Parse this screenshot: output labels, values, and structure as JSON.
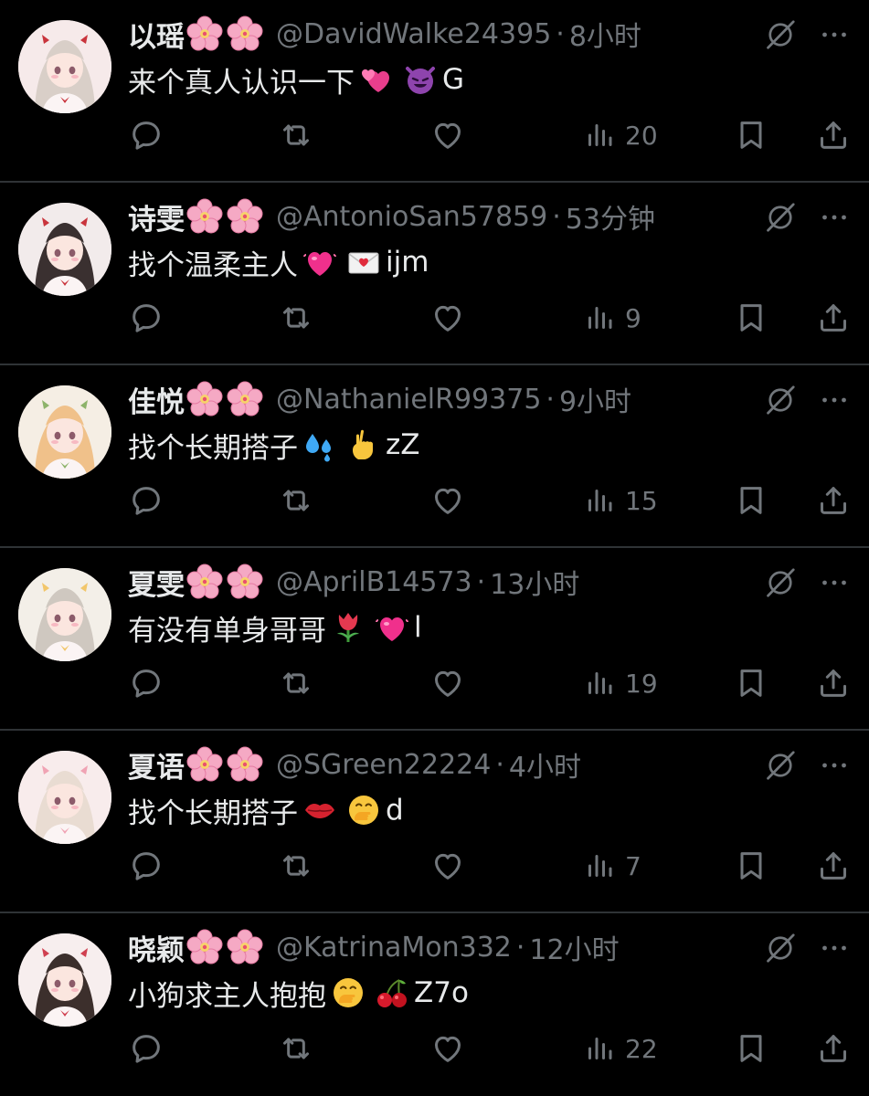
{
  "colors": {
    "background": "#000000",
    "text_primary": "#e7e9ea",
    "text_secondary": "#71767b",
    "divider": "#2f3336"
  },
  "icons": {
    "reply": "reply-icon",
    "retweet": "retweet-icon",
    "like": "heart-icon",
    "views": "views-chart-icon",
    "bookmark": "bookmark-icon",
    "share": "share-icon",
    "grok": "grok-icon",
    "more": "more-icon"
  },
  "tweets": [
    {
      "name": "以瑶",
      "handle": "@DavidWalke24395",
      "separator": "·",
      "time": "8小时",
      "text": "来个真人认识一下",
      "emojis": [
        "two-hearts-emoji",
        "smiling-devil-emoji"
      ],
      "suffix": "G",
      "views": "20"
    },
    {
      "name": "诗雯",
      "handle": "@AntonioSan57859",
      "separator": "·",
      "time": "53分钟",
      "text": "找个温柔主人",
      "emojis": [
        "beating-heart-emoji",
        "love-letter-emoji"
      ],
      "suffix": "ijm",
      "views": "9"
    },
    {
      "name": "佳悦",
      "handle": "@NathanielR99375",
      "separator": "·",
      "time": "9小时",
      "text": "找个长期搭子",
      "emojis": [
        "sweat-droplets-emoji",
        "crossed-fingers-emoji"
      ],
      "suffix": "zZ",
      "views": "15"
    },
    {
      "name": "夏雯",
      "handle": "@AprilB14573",
      "separator": "·",
      "time": "13小时",
      "text": "有没有单身哥哥",
      "emojis": [
        "tulip-emoji",
        "beating-heart-emoji"
      ],
      "suffix": "l",
      "views": "19"
    },
    {
      "name": "夏语",
      "handle": "@SGreen22224",
      "separator": "·",
      "time": "4小时",
      "text": "找个长期搭子",
      "emojis": [
        "kiss-mark-emoji",
        "hand-over-mouth-emoji"
      ],
      "suffix": "d",
      "views": "7"
    },
    {
      "name": "晓颖",
      "handle": "@KatrinaMon332",
      "separator": "·",
      "time": "12小时",
      "text": "小狗求主人抱抱",
      "emojis": [
        "hand-over-mouth-emoji",
        "cherries-emoji"
      ],
      "suffix": "Z7o",
      "views": "22"
    }
  ]
}
